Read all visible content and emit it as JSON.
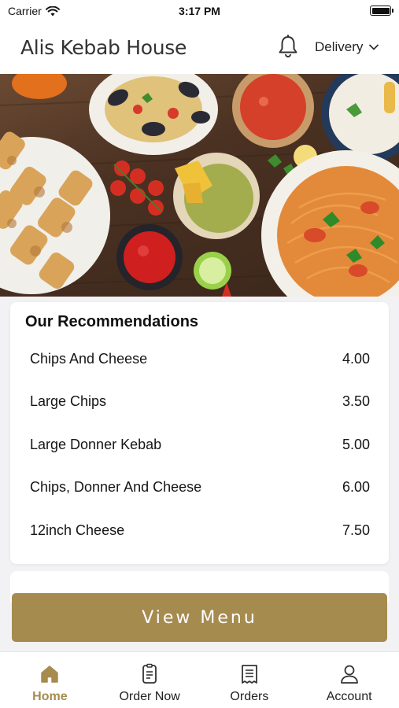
{
  "status_bar": {
    "carrier": "Carrier",
    "time": "3:17 PM"
  },
  "header": {
    "title": "Alis Kebab House",
    "delivery_label": "Delivery"
  },
  "hero": {
    "icon": "food-banner-image"
  },
  "recommendations": {
    "title": "Our Recommendations",
    "items": [
      {
        "name": "Chips And Cheese",
        "price": "4.00"
      },
      {
        "name": "Large Chips",
        "price": "3.50"
      },
      {
        "name": "Large Donner Kebab",
        "price": "5.00"
      },
      {
        "name": "Chips, Donner And Cheese",
        "price": "6.00"
      },
      {
        "name": "12inch Cheese",
        "price": "7.50"
      }
    ]
  },
  "view_menu_label": "View Menu",
  "tabs": [
    {
      "label": "Home",
      "icon": "home-icon",
      "active": true
    },
    {
      "label": "Order Now",
      "icon": "order-icon",
      "active": false
    },
    {
      "label": "Orders",
      "icon": "receipt-icon",
      "active": false
    },
    {
      "label": "Account",
      "icon": "user-icon",
      "active": false
    }
  ],
  "colors": {
    "accent": "#a68b4f",
    "background": "#f2f2f4",
    "text": "#111111"
  }
}
